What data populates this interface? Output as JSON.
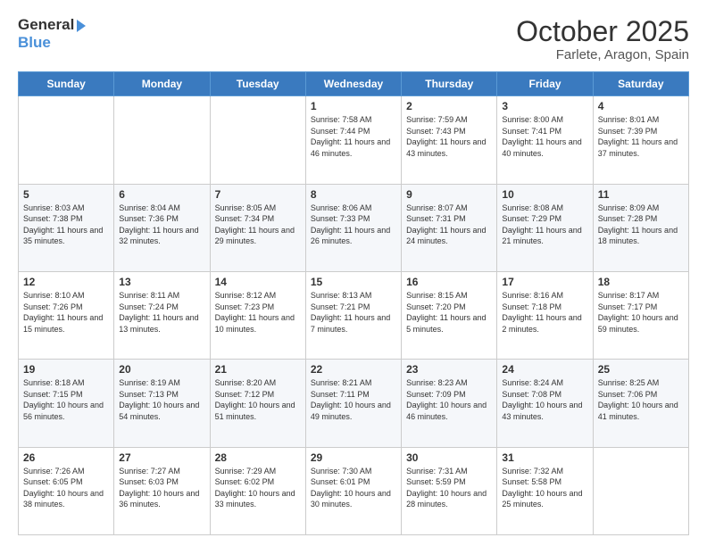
{
  "header": {
    "logo_general": "General",
    "logo_blue": "Blue",
    "month_title": "October 2025",
    "location": "Farlete, Aragon, Spain"
  },
  "weekdays": [
    "Sunday",
    "Monday",
    "Tuesday",
    "Wednesday",
    "Thursday",
    "Friday",
    "Saturday"
  ],
  "days": [
    {
      "num": "",
      "sunrise": "",
      "sunset": "",
      "daylight": ""
    },
    {
      "num": "",
      "sunrise": "",
      "sunset": "",
      "daylight": ""
    },
    {
      "num": "",
      "sunrise": "",
      "sunset": "",
      "daylight": ""
    },
    {
      "num": "1",
      "sunrise": "7:58 AM",
      "sunset": "7:44 PM",
      "daylight": "11 hours and 46 minutes."
    },
    {
      "num": "2",
      "sunrise": "7:59 AM",
      "sunset": "7:43 PM",
      "daylight": "11 hours and 43 minutes."
    },
    {
      "num": "3",
      "sunrise": "8:00 AM",
      "sunset": "7:41 PM",
      "daylight": "11 hours and 40 minutes."
    },
    {
      "num": "4",
      "sunrise": "8:01 AM",
      "sunset": "7:39 PM",
      "daylight": "11 hours and 37 minutes."
    },
    {
      "num": "5",
      "sunrise": "8:03 AM",
      "sunset": "7:38 PM",
      "daylight": "11 hours and 35 minutes."
    },
    {
      "num": "6",
      "sunrise": "8:04 AM",
      "sunset": "7:36 PM",
      "daylight": "11 hours and 32 minutes."
    },
    {
      "num": "7",
      "sunrise": "8:05 AM",
      "sunset": "7:34 PM",
      "daylight": "11 hours and 29 minutes."
    },
    {
      "num": "8",
      "sunrise": "8:06 AM",
      "sunset": "7:33 PM",
      "daylight": "11 hours and 26 minutes."
    },
    {
      "num": "9",
      "sunrise": "8:07 AM",
      "sunset": "7:31 PM",
      "daylight": "11 hours and 24 minutes."
    },
    {
      "num": "10",
      "sunrise": "8:08 AM",
      "sunset": "7:29 PM",
      "daylight": "11 hours and 21 minutes."
    },
    {
      "num": "11",
      "sunrise": "8:09 AM",
      "sunset": "7:28 PM",
      "daylight": "11 hours and 18 minutes."
    },
    {
      "num": "12",
      "sunrise": "8:10 AM",
      "sunset": "7:26 PM",
      "daylight": "11 hours and 15 minutes."
    },
    {
      "num": "13",
      "sunrise": "8:11 AM",
      "sunset": "7:24 PM",
      "daylight": "11 hours and 13 minutes."
    },
    {
      "num": "14",
      "sunrise": "8:12 AM",
      "sunset": "7:23 PM",
      "daylight": "11 hours and 10 minutes."
    },
    {
      "num": "15",
      "sunrise": "8:13 AM",
      "sunset": "7:21 PM",
      "daylight": "11 hours and 7 minutes."
    },
    {
      "num": "16",
      "sunrise": "8:15 AM",
      "sunset": "7:20 PM",
      "daylight": "11 hours and 5 minutes."
    },
    {
      "num": "17",
      "sunrise": "8:16 AM",
      "sunset": "7:18 PM",
      "daylight": "11 hours and 2 minutes."
    },
    {
      "num": "18",
      "sunrise": "8:17 AM",
      "sunset": "7:17 PM",
      "daylight": "10 hours and 59 minutes."
    },
    {
      "num": "19",
      "sunrise": "8:18 AM",
      "sunset": "7:15 PM",
      "daylight": "10 hours and 56 minutes."
    },
    {
      "num": "20",
      "sunrise": "8:19 AM",
      "sunset": "7:13 PM",
      "daylight": "10 hours and 54 minutes."
    },
    {
      "num": "21",
      "sunrise": "8:20 AM",
      "sunset": "7:12 PM",
      "daylight": "10 hours and 51 minutes."
    },
    {
      "num": "22",
      "sunrise": "8:21 AM",
      "sunset": "7:11 PM",
      "daylight": "10 hours and 49 minutes."
    },
    {
      "num": "23",
      "sunrise": "8:23 AM",
      "sunset": "7:09 PM",
      "daylight": "10 hours and 46 minutes."
    },
    {
      "num": "24",
      "sunrise": "8:24 AM",
      "sunset": "7:08 PM",
      "daylight": "10 hours and 43 minutes."
    },
    {
      "num": "25",
      "sunrise": "8:25 AM",
      "sunset": "7:06 PM",
      "daylight": "10 hours and 41 minutes."
    },
    {
      "num": "26",
      "sunrise": "7:26 AM",
      "sunset": "6:05 PM",
      "daylight": "10 hours and 38 minutes."
    },
    {
      "num": "27",
      "sunrise": "7:27 AM",
      "sunset": "6:03 PM",
      "daylight": "10 hours and 36 minutes."
    },
    {
      "num": "28",
      "sunrise": "7:29 AM",
      "sunset": "6:02 PM",
      "daylight": "10 hours and 33 minutes."
    },
    {
      "num": "29",
      "sunrise": "7:30 AM",
      "sunset": "6:01 PM",
      "daylight": "10 hours and 30 minutes."
    },
    {
      "num": "30",
      "sunrise": "7:31 AM",
      "sunset": "5:59 PM",
      "daylight": "10 hours and 28 minutes."
    },
    {
      "num": "31",
      "sunrise": "7:32 AM",
      "sunset": "5:58 PM",
      "daylight": "10 hours and 25 minutes."
    },
    {
      "num": "",
      "sunrise": "",
      "sunset": "",
      "daylight": ""
    }
  ]
}
